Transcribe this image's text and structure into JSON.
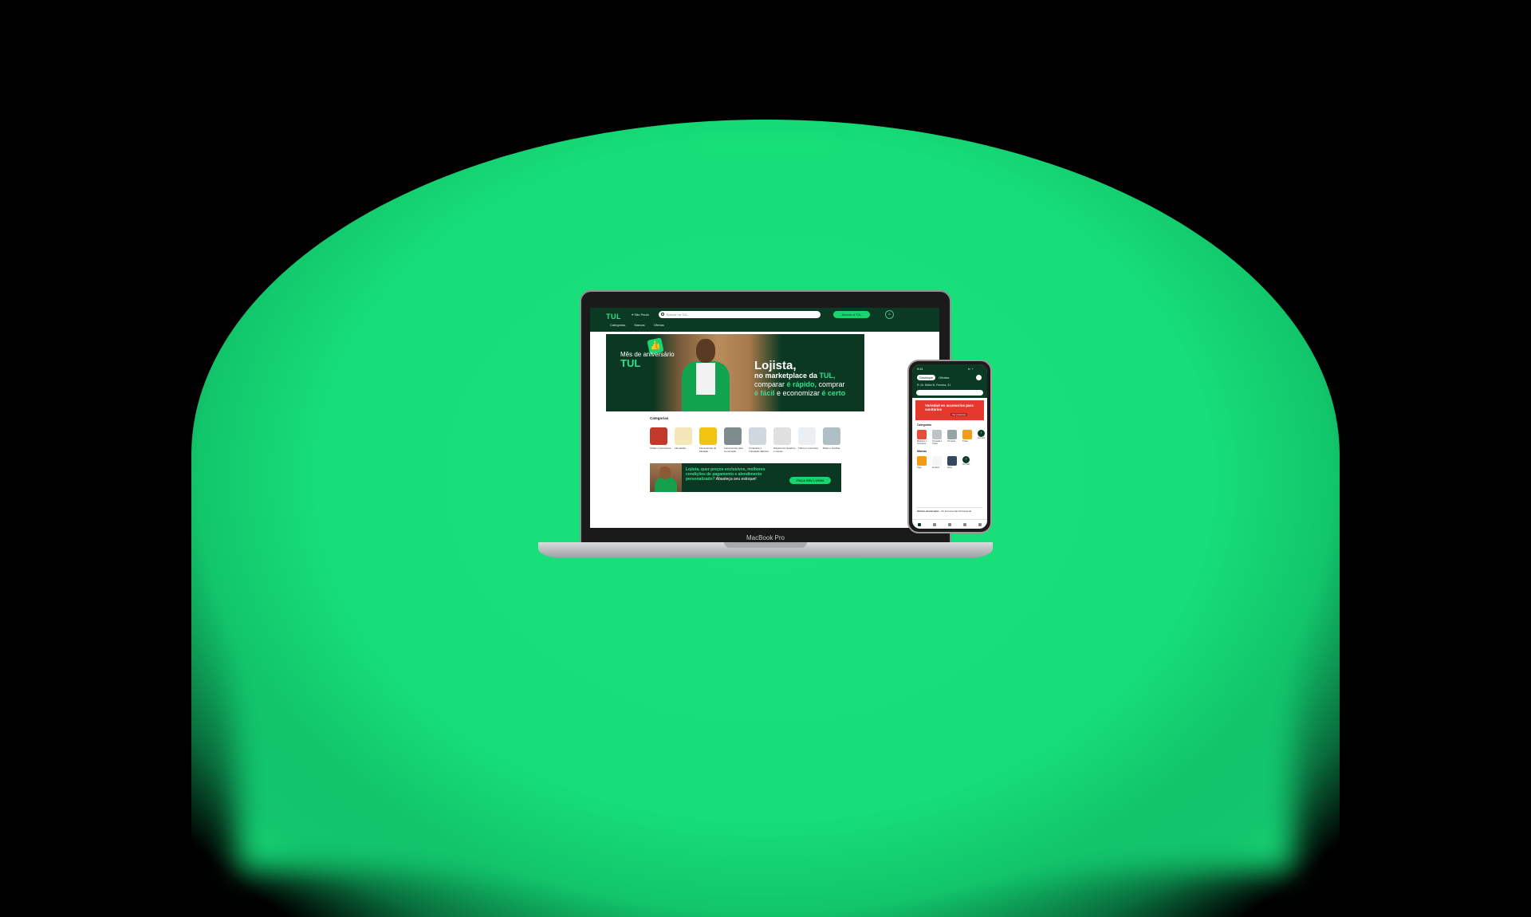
{
  "laptop": {
    "model_label": "MacBook Pro",
    "header": {
      "logo": "TUL",
      "location": "São Paulo",
      "search_placeholder": "Buscar na TUL",
      "access_button": "Acesse a TUL",
      "nav": [
        "Categorias",
        "Marcas",
        "Ofertas"
      ]
    },
    "hero": {
      "left_small": "Mês de aniversário",
      "left_brand": "TUL",
      "title": "Lojista,",
      "line2_prefix": "no marketplace da ",
      "line2_brand": "TUL,",
      "line3_prefix": "comparar ",
      "line3_hl": "é rápido,",
      "line3_suffix": " comprar",
      "line4_hl": "é fácil",
      "line4_mid": " e economizar ",
      "line4_hl2": "é certo"
    },
    "categories_title": "Categorias",
    "categories": [
      {
        "label": "Telhas e Acessórios",
        "color": "#c0392b"
      },
      {
        "label": "Lâmpadas",
        "color": "#f3e7b8"
      },
      {
        "label": "Ferramentas de Medição",
        "color": "#f1c40f"
      },
      {
        "label": "Ferramentas para Construção",
        "color": "#7f8c8d"
      },
      {
        "label": "Condulete e Tubulação Elétrica",
        "color": "#cfd8dc"
      },
      {
        "label": "Disjuntores Quadros e Caixas",
        "color": "#e0e0e0"
      },
      {
        "label": "Tubos e Conexões",
        "color": "#eceff1"
      },
      {
        "label": "Ralos e Grelhas",
        "color": "#b0bec5"
      }
    ],
    "promo": {
      "text_hl": "Lojista, quer preços exclusivos, melhores condições de pagamento e atendimento personalizado?",
      "text_plain": " Abasteça seu estoque!",
      "button": "FAÇA SEU LOGIN"
    }
  },
  "phone": {
    "time": "9:41",
    "status": "▪▪ ◔",
    "tabs": [
      "Destaque",
      "Ofertas"
    ],
    "location": "R. Dr. Mário N. Ferreira, 31",
    "search_placeholder": "Buscar na TUL",
    "banner_title": "Variedad en accesorios para sanitários",
    "banner_badge": "Ver produtos",
    "categories_title": "Categorias",
    "categories": [
      {
        "label": "Banheiro e Chuveiros",
        "color": "#e74c3c"
      },
      {
        "label": "Conexão e Tubos",
        "color": "#bdc3c7"
      },
      {
        "label": "Torneiras",
        "color": "#95a5a6"
      },
      {
        "label": "Tintas",
        "color": "#f39c12"
      }
    ],
    "categories_more": "Ver tudo",
    "brands_title": "Marcas",
    "brands": [
      {
        "label": "Tigre",
        "color": "#f39c12"
      },
      {
        "label": "Amanco",
        "color": "#f5f5f5"
      },
      {
        "label": "Deca",
        "color": "#34495e"
      }
    ],
    "brands_more": "Ver tudo",
    "offers_title": "Ofertas destacadas",
    "offer_text": "Kit Ferramentas Profissional"
  }
}
